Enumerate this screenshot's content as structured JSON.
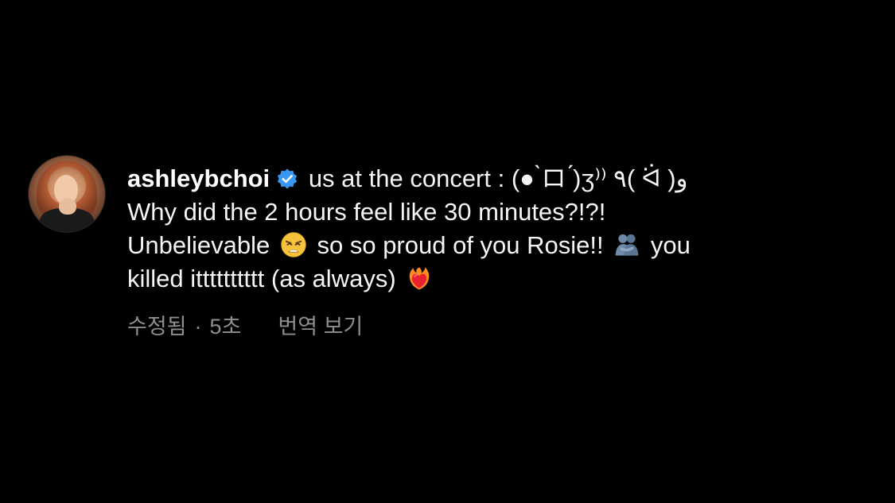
{
  "comment": {
    "username": "ashleybchoi",
    "verified": true,
    "line1_text": "us at the concert : (● ̀ロ ́)ʒ⁾⁾ ٩( ᐛ )و",
    "line2_text": "Why did the 2 hours feel like 30 minutes?!?!",
    "line3_a": "Unbelievable",
    "line3_b": "so so proud of you Rosie!!",
    "line3_c": "you",
    "line4_a": "killed itttttttttt (as always)",
    "emojis": [
      "weary-face-emoji",
      "people-hugging-emoji",
      "heart-on-fire-emoji"
    ]
  },
  "meta": {
    "edited": "수정됨",
    "separator": "·",
    "time": "5초",
    "translate": "번역 보기"
  },
  "colors": {
    "background": "#000000",
    "text": "#f5f5f5",
    "muted": "#8e8e8e",
    "verified_badge": "#3897f0"
  }
}
